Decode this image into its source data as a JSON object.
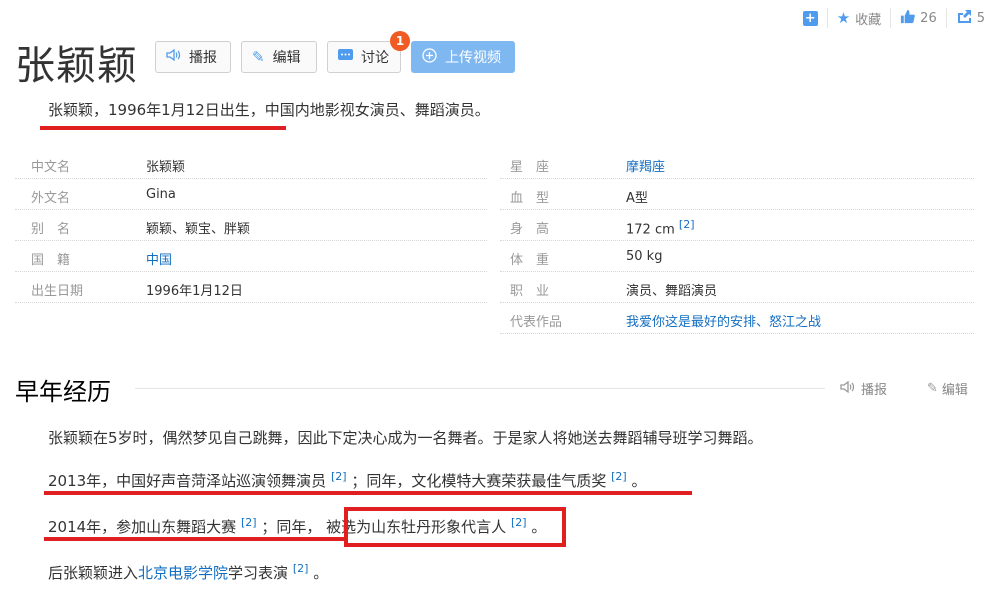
{
  "toolbar": {
    "favorite_label": "收藏",
    "like_count": "26",
    "share_count": "5"
  },
  "title": "张颖颖",
  "buttons": {
    "broadcast": "播报",
    "edit": "编辑",
    "discuss": "讨论",
    "discuss_badge": "1",
    "upload": "上传视频"
  },
  "lead": "张颖颖，1996年1月12日出生，中国内地影视女演员、舞蹈演员。",
  "info_left": [
    {
      "key": "中文名",
      "value": "张颖颖"
    },
    {
      "key": "外文名",
      "value": "Gina"
    },
    {
      "key": "别　名",
      "value": "颖颖、颖宝、胖颖"
    },
    {
      "key": "国　籍",
      "value": "中国"
    },
    {
      "key": "出生日期",
      "value": "1996年1月12日"
    }
  ],
  "info_right": [
    {
      "key": "星　座",
      "value": "摩羯座"
    },
    {
      "key": "血　型",
      "value": "A型"
    },
    {
      "key": "身　高",
      "value": "172 cm",
      "ref": "[2]"
    },
    {
      "key": "体　重",
      "value": "50 kg"
    },
    {
      "key": "职　业",
      "value": "演员、舞蹈演员"
    },
    {
      "key": "代表作品",
      "value": "我爱你这是最好的安排、怒江之战"
    }
  ],
  "section": {
    "title": "早年经历",
    "broadcast": "播报",
    "edit": "编辑",
    "paragraphs": {
      "p1": "张颖颖在5岁时，偶然梦见自己跳舞，因此下定决心成为一名舞者。于是家人将她送去舞蹈辅导班学习舞蹈。",
      "p2a": "2013年，中国好声音菏泽站巡演领舞演员",
      "p2b": "；同年，文化模特大赛荣获最佳气质奖",
      "p2c": "。",
      "p3a": "2014年，参加山东舞蹈大赛",
      "p3b": "；同年，",
      "p3c": "被选为山东牡丹形象代言人",
      "p3d": "。",
      "p4a": "后张颖颖进入",
      "p4link": "北京电影学院",
      "p4b": "学习表演",
      "p4c": "。",
      "ref": "[2]"
    }
  }
}
